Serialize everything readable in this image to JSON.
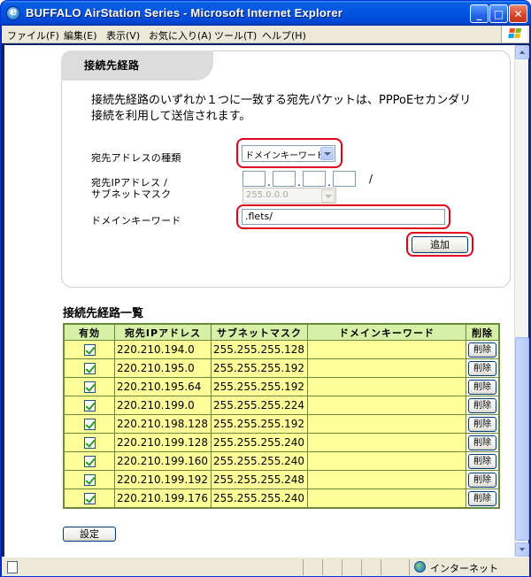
{
  "window": {
    "title": "BUFFALO AirStation Series - Microsoft Internet Explorer"
  },
  "menu": [
    "ファイル(F)",
    "編集(E)",
    "表示(V)",
    "お気に入り(A)",
    "ツール(T)",
    "ヘルプ(H)"
  ],
  "panel": {
    "tab_label": "接続先経路",
    "description": "接続先経路のいずれか１つに一致する宛先パケットは、PPPoEセカンダリ接続を利用して送信されます。",
    "dest_type_label": "宛先アドレスの種類",
    "dest_type_value": "ドメインキーワード",
    "ip_label_line1": "宛先IPアドレス /",
    "ip_label_line2": "サブネットマスク",
    "slash": "/",
    "subnet_value": "255.0.0.0",
    "domain_label": "ドメインキーワード",
    "domain_value": ".flets/",
    "add_button": "追加"
  },
  "list": {
    "title": "接続先経路一覧",
    "headers": [
      "有効",
      "宛先IPアドレス",
      "サブネットマスク",
      "ドメインキーワード",
      "削除"
    ],
    "delete_label": "削除",
    "rows": [
      {
        "enabled": true,
        "ip": "220.210.194.0",
        "mask": "255.255.255.128",
        "keyword": ""
      },
      {
        "enabled": true,
        "ip": "220.210.195.0",
        "mask": "255.255.255.192",
        "keyword": ""
      },
      {
        "enabled": true,
        "ip": "220.210.195.64",
        "mask": "255.255.255.192",
        "keyword": ""
      },
      {
        "enabled": true,
        "ip": "220.210.199.0",
        "mask": "255.255.255.224",
        "keyword": ""
      },
      {
        "enabled": true,
        "ip": "220.210.198.128",
        "mask": "255.255.255.192",
        "keyword": ""
      },
      {
        "enabled": true,
        "ip": "220.210.199.128",
        "mask": "255.255.255.240",
        "keyword": ""
      },
      {
        "enabled": true,
        "ip": "220.210.199.160",
        "mask": "255.255.255.240",
        "keyword": ""
      },
      {
        "enabled": true,
        "ip": "220.210.199.192",
        "mask": "255.255.255.248",
        "keyword": ""
      },
      {
        "enabled": true,
        "ip": "220.210.199.176",
        "mask": "255.255.255.240",
        "keyword": ""
      }
    ]
  },
  "settings_button": "設定",
  "status": {
    "zone": "インターネット"
  }
}
